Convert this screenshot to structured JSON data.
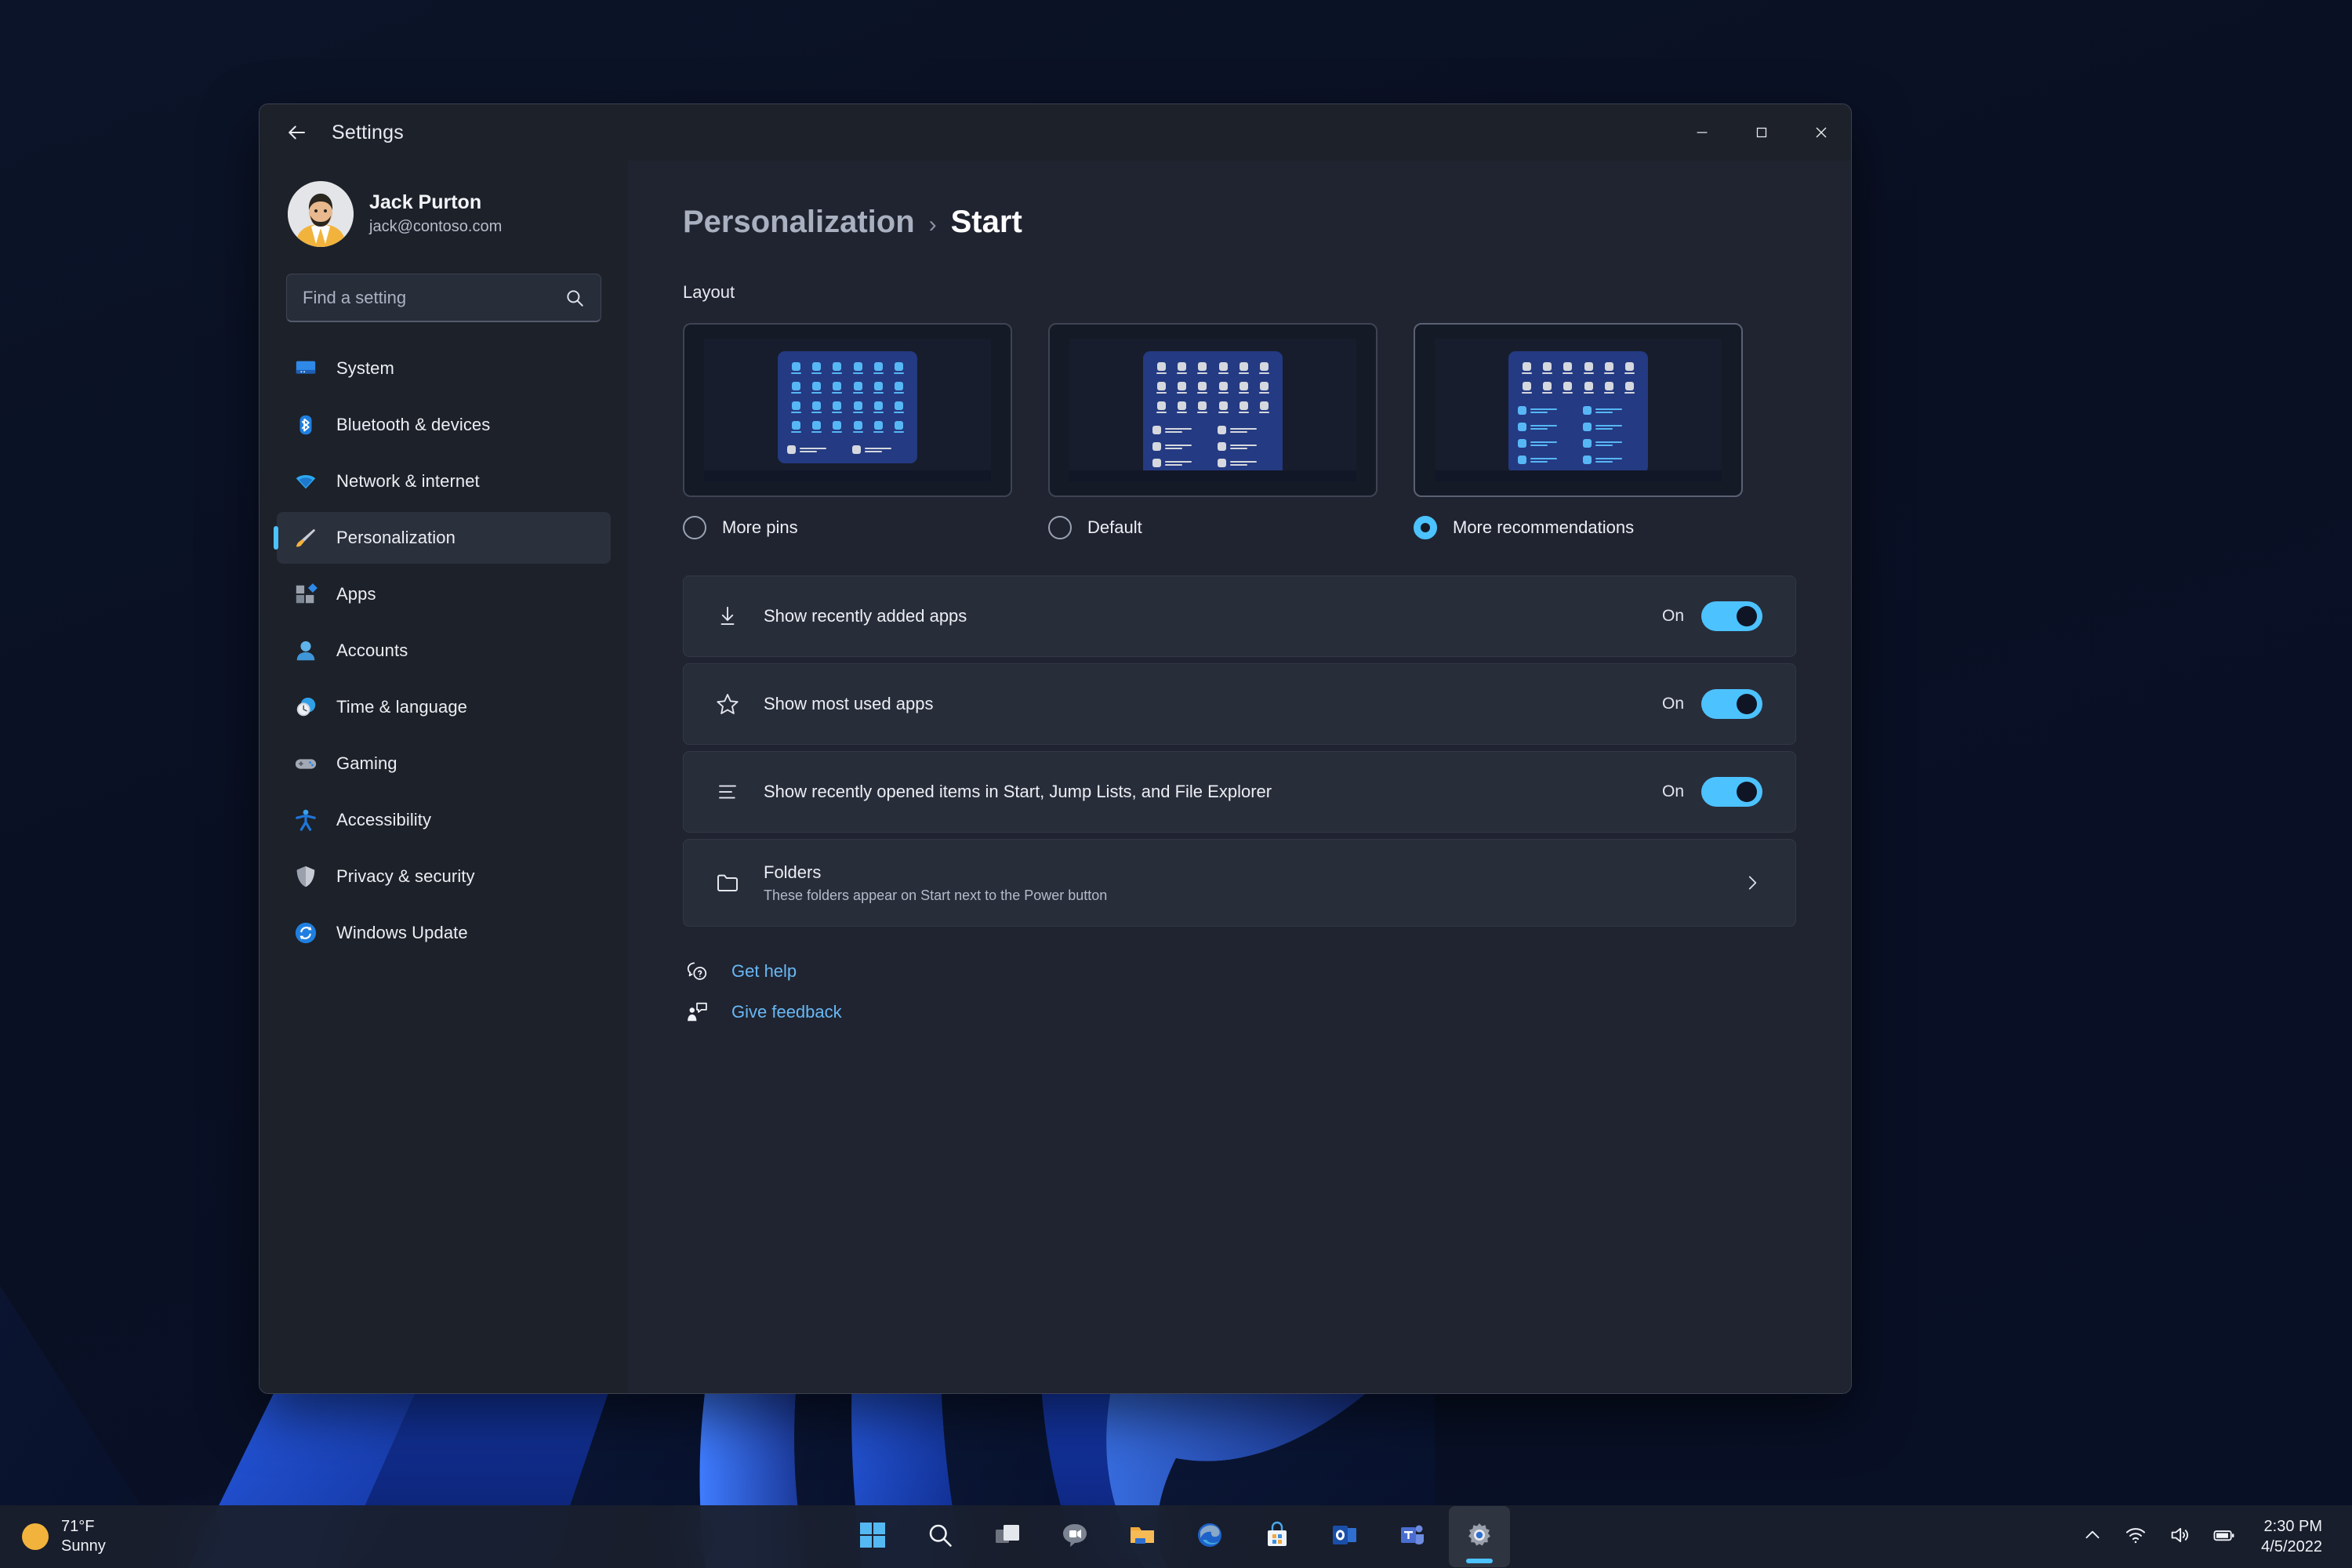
{
  "window": {
    "title": "Settings",
    "back_icon": "back-arrow-icon",
    "controls": {
      "minimize": "minimize-icon",
      "maximize": "maximize-icon",
      "close": "close-icon"
    }
  },
  "sidebar": {
    "account": {
      "name": "Jack Purton",
      "email": "jack@contoso.com"
    },
    "search": {
      "placeholder": "Find a setting",
      "value": "",
      "icon": "search-icon"
    },
    "items": [
      {
        "label": "System",
        "icon": "system-monitor-icon",
        "selected": false
      },
      {
        "label": "Bluetooth & devices",
        "icon": "bluetooth-icon",
        "selected": false
      },
      {
        "label": "Network & internet",
        "icon": "wifi-icon",
        "selected": false
      },
      {
        "label": "Personalization",
        "icon": "paintbrush-icon",
        "selected": true
      },
      {
        "label": "Apps",
        "icon": "apps-blocks-icon",
        "selected": false
      },
      {
        "label": "Accounts",
        "icon": "person-icon",
        "selected": false
      },
      {
        "label": "Time & language",
        "icon": "clock-globe-icon",
        "selected": false
      },
      {
        "label": "Gaming",
        "icon": "gamepad-icon",
        "selected": false
      },
      {
        "label": "Accessibility",
        "icon": "accessibility-icon",
        "selected": false
      },
      {
        "label": "Privacy & security",
        "icon": "shield-icon",
        "selected": false
      },
      {
        "label": "Windows Update",
        "icon": "update-refresh-icon",
        "selected": false
      }
    ]
  },
  "main": {
    "breadcrumb": {
      "parent": "Personalization",
      "separator": "›",
      "current": "Start"
    },
    "layout_heading": "Layout",
    "layout_options": [
      {
        "label": "More pins",
        "selected": false,
        "pin_rows": 4,
        "rec_rows": 1,
        "pin_color": "blue",
        "rec_color": "gray"
      },
      {
        "label": "Default",
        "selected": false,
        "pin_rows": 3,
        "rec_rows": 3,
        "pin_color": "gray",
        "rec_color": "gray"
      },
      {
        "label": "More recommendations",
        "selected": true,
        "pin_rows": 2,
        "rec_rows": 4,
        "pin_color": "gray",
        "rec_color": "blue"
      }
    ],
    "settings": [
      {
        "title": "Show recently added apps",
        "subtitle": "",
        "icon": "download-arrow-icon",
        "control": "toggle",
        "state": "On"
      },
      {
        "title": "Show most used apps",
        "subtitle": "",
        "icon": "star-icon",
        "control": "toggle",
        "state": "On"
      },
      {
        "title": "Show recently opened items in Start, Jump Lists, and File Explorer",
        "subtitle": "",
        "icon": "list-lines-icon",
        "control": "toggle",
        "state": "On"
      },
      {
        "title": "Folders",
        "subtitle": "These folders appear on Start next to the Power button",
        "icon": "folder-icon",
        "control": "chevron",
        "state": ""
      }
    ],
    "footer_links": [
      {
        "label": "Get help",
        "icon": "help-question-bubble-icon"
      },
      {
        "label": "Give feedback",
        "icon": "feedback-person-icon"
      }
    ]
  },
  "taskbar": {
    "weather": {
      "temperature": "71°F",
      "condition": "Sunny",
      "icon": "sun-icon"
    },
    "apps": [
      {
        "name": "start-button",
        "icon": "windows-logo-icon",
        "active": false
      },
      {
        "name": "search-button",
        "icon": "search-icon",
        "active": false
      },
      {
        "name": "task-view-button",
        "icon": "task-view-icon",
        "active": false
      },
      {
        "name": "chat-button",
        "icon": "chat-video-icon",
        "active": false
      },
      {
        "name": "file-explorer",
        "icon": "folder-icon",
        "active": false
      },
      {
        "name": "microsoft-edge",
        "icon": "edge-icon",
        "active": false
      },
      {
        "name": "microsoft-store",
        "icon": "store-bag-icon",
        "active": false
      },
      {
        "name": "outlook",
        "icon": "outlook-icon",
        "active": false
      },
      {
        "name": "microsoft-teams",
        "icon": "teams-icon",
        "active": false
      },
      {
        "name": "settings",
        "icon": "gear-icon",
        "active": true
      }
    ],
    "tray": {
      "overflow_icon": "chevron-up-icon",
      "network_icon": "wifi-icon",
      "volume_icon": "speaker-icon",
      "battery_icon": "battery-icon",
      "time": "2:30 PM",
      "date": "4/5/2022"
    }
  },
  "colors": {
    "accent": "#4cc2ff",
    "link": "#68b8f5",
    "window_bg": "#202430",
    "sidebar_bg": "#1d2129",
    "card_bg": "#282d3a"
  }
}
